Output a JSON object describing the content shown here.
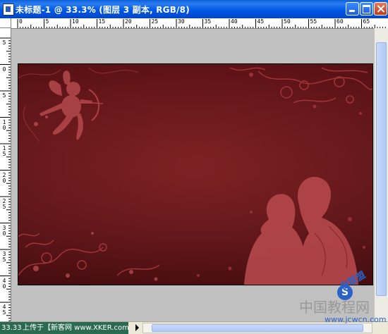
{
  "window": {
    "title": "未标题-1 @ 33.3% (图层 3 副本, RGB/8)",
    "icon": "photoshop-document-icon"
  },
  "ruler_top_labels": [
    "0",
    "5",
    "10",
    "15",
    "20",
    "25",
    "30",
    "35",
    "40",
    "45",
    "50",
    "55",
    "60",
    "65"
  ],
  "ruler_left_labels": [
    "5",
    "0",
    "5",
    "10",
    "15",
    "20",
    "25",
    "30",
    "35",
    "40",
    "45"
  ],
  "statusbar": {
    "zoom": "33.33",
    "info": "上传于【新客网 www.XKER.com】"
  },
  "watermark": {
    "logo_text": "自联盟",
    "circle_letter": "S",
    "chinese": "中国教程网",
    "url": "www.jcwcn.com"
  },
  "colors": {
    "canvas_bg": "#c0c0c0",
    "doc_bg": "#621518",
    "ornament": "#a8383c"
  }
}
